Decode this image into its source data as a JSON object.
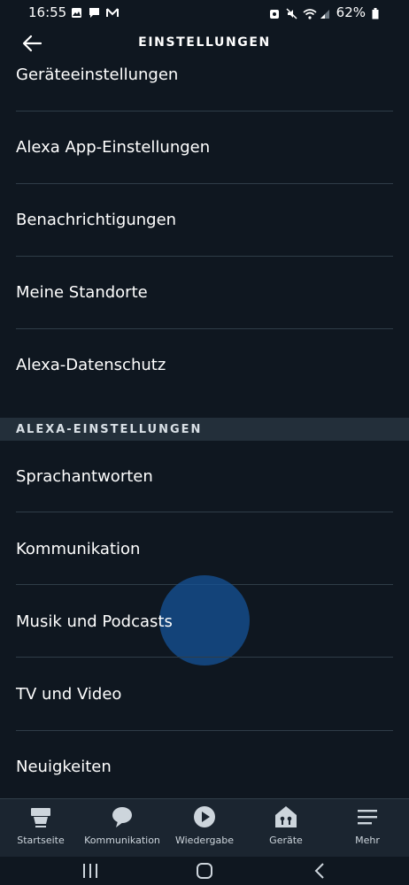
{
  "status_bar": {
    "time": "16:55",
    "battery": "62%"
  },
  "header": {
    "title": "EINSTELLUNGEN"
  },
  "settings_items": [
    {
      "label": "Geräteeinstellungen"
    },
    {
      "label": "Alexa App-Einstellungen"
    },
    {
      "label": "Benachrichtigungen"
    },
    {
      "label": "Meine Standorte"
    },
    {
      "label": "Alexa-Datenschutz"
    }
  ],
  "section": {
    "label": "ALEXA-EINSTELLUNGEN"
  },
  "alexa_items": [
    {
      "label": "Sprachantworten"
    },
    {
      "label": "Kommunikation"
    },
    {
      "label": "Musik und Podcasts"
    },
    {
      "label": "TV und Video"
    },
    {
      "label": "Neuigkeiten"
    }
  ],
  "bottom_nav": [
    {
      "label": "Startseite",
      "icon": "home-icon"
    },
    {
      "label": "Kommunikation",
      "icon": "chat-bubble-icon"
    },
    {
      "label": "Wiedergabe",
      "icon": "play-icon"
    },
    {
      "label": "Geräte",
      "icon": "devices-house-icon"
    },
    {
      "label": "Mehr",
      "icon": "menu-icon"
    }
  ],
  "colors": {
    "background": "#0f1720",
    "divider": "#2f3d48",
    "section_bg": "#232f3a",
    "nav_bg": "#1b2530",
    "touch": "#15559b"
  }
}
